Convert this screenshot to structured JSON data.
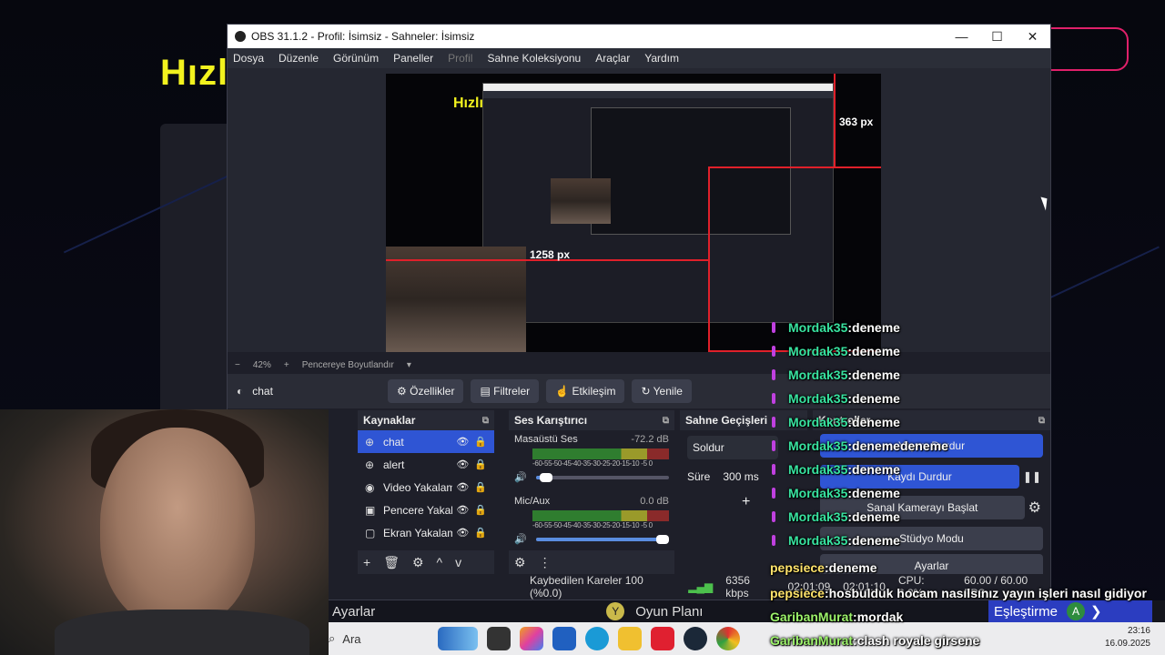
{
  "window": {
    "title": "OBS 31.1.2 - Profil: İsimsiz - Sahneler: İsimsiz",
    "controls": [
      "—",
      "☐",
      "✕"
    ]
  },
  "background": {
    "brand_text": "Hızlı"
  },
  "menu": [
    {
      "label": "Dosya",
      "enabled": true
    },
    {
      "label": "Düzenle",
      "enabled": true
    },
    {
      "label": "Görünüm",
      "enabled": true
    },
    {
      "label": "Paneller",
      "enabled": true
    },
    {
      "label": "Profil",
      "enabled": false
    },
    {
      "label": "Sahne Koleksiyonu",
      "enabled": true
    },
    {
      "label": "Araçlar",
      "enabled": true
    },
    {
      "label": "Yardım",
      "enabled": true
    }
  ],
  "preview": {
    "brand_text": "Hızlı",
    "size_label_1": "363 px",
    "size_label_2": "1258 px"
  },
  "zoom": {
    "minus": "−",
    "level": "42%",
    "plus": "+",
    "fit": "Pencereye Boyutlandır",
    "dropdown": "▾"
  },
  "source_bar": {
    "selected_source": "chat",
    "buttons": [
      {
        "icon": "⚙",
        "label": "Özellikler"
      },
      {
        "icon": "▤",
        "label": "Filtreler"
      },
      {
        "icon": "☝",
        "label": "Etkileşim"
      },
      {
        "icon": "↻",
        "label": "Yenile"
      }
    ]
  },
  "sources": {
    "title": "Kaynaklar",
    "items": [
      {
        "icon": "⊕",
        "label": "chat",
        "selected": true
      },
      {
        "icon": "⊕",
        "label": "alert",
        "selected": false
      },
      {
        "icon": "◉",
        "label": "Video Yakalama",
        "selected": false
      },
      {
        "icon": "▣",
        "label": "Pencere Yakala",
        "selected": false
      },
      {
        "icon": "▢",
        "label": "Ekran Yakalama",
        "selected": false
      }
    ],
    "footer": [
      "+",
      "🗑",
      "⚙",
      "^",
      "v"
    ]
  },
  "mixer": {
    "title": "Ses Karıştırıcı",
    "scale": "-60-55-50-45-40-35-30-25-20-15-10 -5  0",
    "channels": [
      {
        "name": "Masaüstü Ses",
        "db": "-72.2 dB",
        "level": 0.08
      },
      {
        "name": "Mic/Aux",
        "db": "0.0 dB",
        "level": 1.0
      }
    ],
    "footer": [
      "⚙",
      "⋮"
    ]
  },
  "transitions": {
    "title": "Sahne Geçişleri",
    "type": "Soldur",
    "duration_label": "Süre",
    "duration": "300 ms",
    "add": "+"
  },
  "controls": {
    "title": "Kontroller",
    "buttons": [
      "Yayını Durdur",
      "Kaydı Durdur",
      "Sanal Kamerayı Başlat",
      "Stüdyo Modu",
      "Ayarlar"
    ],
    "pause_icon": "❚❚",
    "gear_icon": "⚙"
  },
  "status": {
    "dropped": "Kaybedilen Kareler 100 (%0.0)",
    "bitrate": "6356 kbps",
    "live_time": "02:01:09",
    "rec_time": "02:01:10",
    "cpu": "CPU: 6.3%",
    "fps": "60.00 / 60.00 FPS"
  },
  "chat": [
    {
      "user": "Mordak35",
      "msg": "deneme",
      "badge": true
    },
    {
      "user": "Mordak35",
      "msg": "deneme",
      "badge": true
    },
    {
      "user": "Mordak35",
      "msg": "deneme",
      "badge": true
    },
    {
      "user": "Mordak35",
      "msg": "deneme",
      "badge": true
    },
    {
      "user": "Mordak35",
      "msg": "deneme",
      "badge": true
    },
    {
      "user": "Mordak35",
      "msg": "denemedeneme",
      "badge": true
    },
    {
      "user": "Mordak35",
      "msg": "deneme",
      "badge": true
    },
    {
      "user": "Mordak35",
      "msg": "deneme",
      "badge": true
    },
    {
      "user": "Mordak35",
      "msg": "deneme",
      "badge": true
    },
    {
      "user": "Mordak35",
      "msg": "deneme",
      "badge": true
    },
    {
      "user": "pepsiece",
      "msg": "deneme",
      "badge": false
    },
    {
      "user": "pepsiece",
      "msg": "hosbulduk hocam nasılsınız yayın işleri nasıl gidiyor",
      "badge": false
    },
    {
      "user": "GaribanMurat",
      "msg": "mordak",
      "badge": false
    },
    {
      "user": "GaribanMurat",
      "msg": "clash royale girsene",
      "badge": false
    }
  ],
  "gamebar": {
    "left": "Ayarlar",
    "y_button": "Y",
    "center": "Oyun Planı",
    "right": "Eşleştirme",
    "a_button": "A",
    "arrow": "❯"
  },
  "taskbar": {
    "search_placeholder": "Ara",
    "time": "23:16",
    "date": "16.09.2025"
  },
  "colors": {
    "accent": "#2f55d4",
    "live_red": "#e0202a",
    "brand_yellow": "#f2f21e",
    "chat_user": "#38e3a0"
  }
}
